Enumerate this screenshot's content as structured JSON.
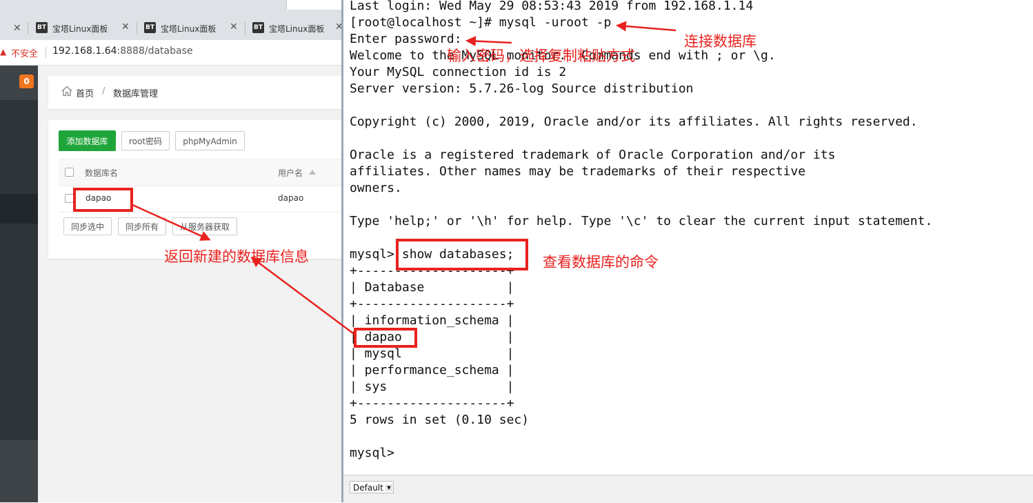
{
  "browser": {
    "tabs": [
      {
        "icon": "BT",
        "label": "宝塔Linux面板",
        "close": "✕"
      },
      {
        "icon": "BT",
        "label": "宝塔Linux面板",
        "close": "✕"
      },
      {
        "icon": "BT",
        "label": "宝塔Linux面板",
        "close": "✕"
      }
    ],
    "first_tab_close": "✕",
    "address": {
      "insecure_label": "不安全",
      "url_host": "192.168.1.64",
      "url_rest": ":8888/database"
    }
  },
  "sidebar": {
    "badge": "0"
  },
  "breadcrumb": {
    "home": "首页",
    "separator": "/",
    "current": "数据库管理"
  },
  "toolbar": {
    "add_db": "添加数据库",
    "root_password": "root密码",
    "phpmyadmin": "phpMyAdmin"
  },
  "table": {
    "headers": {
      "db_name": "数据库名",
      "username": "用户名"
    },
    "rows": [
      {
        "db_name": "dapao",
        "username": "dapao"
      }
    ]
  },
  "actions": {
    "sync_selected": "同步选中",
    "sync_all": "同步所有",
    "fetch_from_server": "从服务器获取"
  },
  "terminal": {
    "lines": [
      "Last login: Wed May 29 08:53:43 2019 from 192.168.1.14",
      "[root@localhost ~]# mysql -uroot -p",
      "Enter password:",
      "Welcome to the MySQL monitor.  Commands end with ; or \\g.",
      "Your MySQL connection id is 2",
      "Server version: 5.7.26-log Source distribution",
      "",
      "Copyright (c) 2000, 2019, Oracle and/or its affiliates. All rights reserved.",
      "",
      "Oracle is a registered trademark of Oracle Corporation and/or its",
      "affiliates. Other names may be trademarks of their respective",
      "owners.",
      "",
      "Type 'help;' or '\\h' for help. Type '\\c' to clear the current input statement.",
      "",
      "mysql> show databases;",
      "+--------------------+",
      "| Database           |",
      "+--------------------+",
      "| information_schema |",
      "| dapao              |",
      "| mysql              |",
      "| performance_schema |",
      "| sys                |",
      "+--------------------+",
      "5 rows in set (0.10 sec)",
      "",
      "mysql> "
    ],
    "status_select": "Default"
  },
  "annotations": {
    "connect": "连接数据库",
    "password": "输入密码，选择复制粘贴方式",
    "command": "查看数据库的命令",
    "result": "返回新建的数据库信息"
  },
  "colors": {
    "accent_green": "#20a53a",
    "annotation_red": "#e8221e",
    "badge_orange": "#f0761e"
  }
}
